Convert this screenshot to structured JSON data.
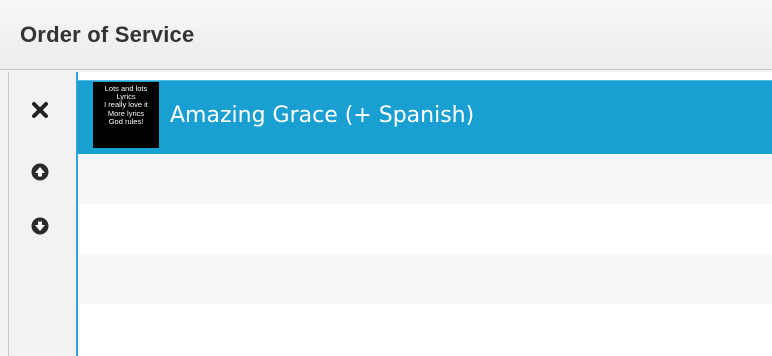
{
  "panel": {
    "title": "Order of Service"
  },
  "toolbar": {
    "buttons": [
      {
        "name": "remove",
        "icon": "close-icon"
      },
      {
        "name": "move-up",
        "icon": "circle-arrow-up-icon"
      },
      {
        "name": "move-down",
        "icon": "circle-arrow-down-icon"
      }
    ]
  },
  "service_items": [
    {
      "title": "Amazing Grace (+ Spanish)",
      "selected": true,
      "thumbnail_lines": [
        "Lots and lots",
        "Lyrics",
        "I really love it",
        "More lyrics",
        "God rules!"
      ]
    }
  ],
  "colors": {
    "selection": "#1a9fd2",
    "focus_border": "#28a6d8",
    "header_text": "#333333"
  }
}
